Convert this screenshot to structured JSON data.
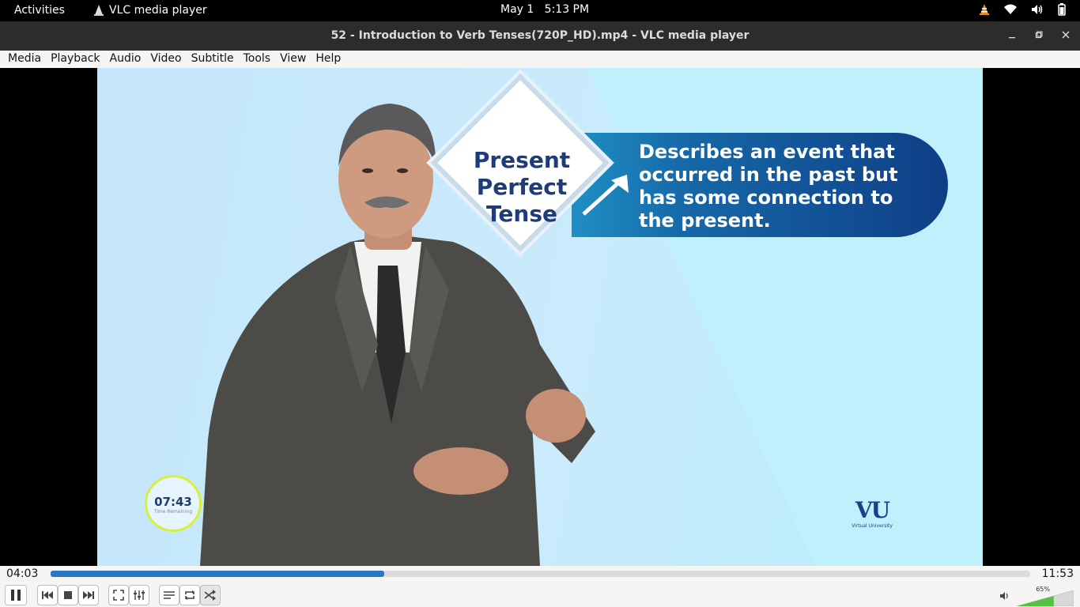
{
  "system_bar": {
    "activities": "Activities",
    "app_name": "VLC media player",
    "date": "May 1",
    "time": "5:13 PM"
  },
  "window": {
    "title": "52 - Introduction to Verb Tenses(720P_HD).mp4 - VLC media player"
  },
  "menu": [
    "Media",
    "Playback",
    "Audio",
    "Video",
    "Subtitle",
    "Tools",
    "View",
    "Help"
  ],
  "video": {
    "diamond_text": [
      "Present",
      "Perfect",
      "Tense"
    ],
    "banner_text": [
      "Describes an event that",
      "occurred in the past but",
      "has some connection to",
      "the present."
    ],
    "timer": "07:43",
    "timer_sub": "Time Remaining",
    "logo": "VU",
    "logo_sub": "Virtual University"
  },
  "player": {
    "current_time": "04:03",
    "total_time": "11:53",
    "progress": 0.341,
    "volume_label": "65%",
    "volume": 0.65
  },
  "colors": {
    "accent": "#2a76c6",
    "banner": "#0f3e86",
    "heading": "#1e3b7a"
  }
}
